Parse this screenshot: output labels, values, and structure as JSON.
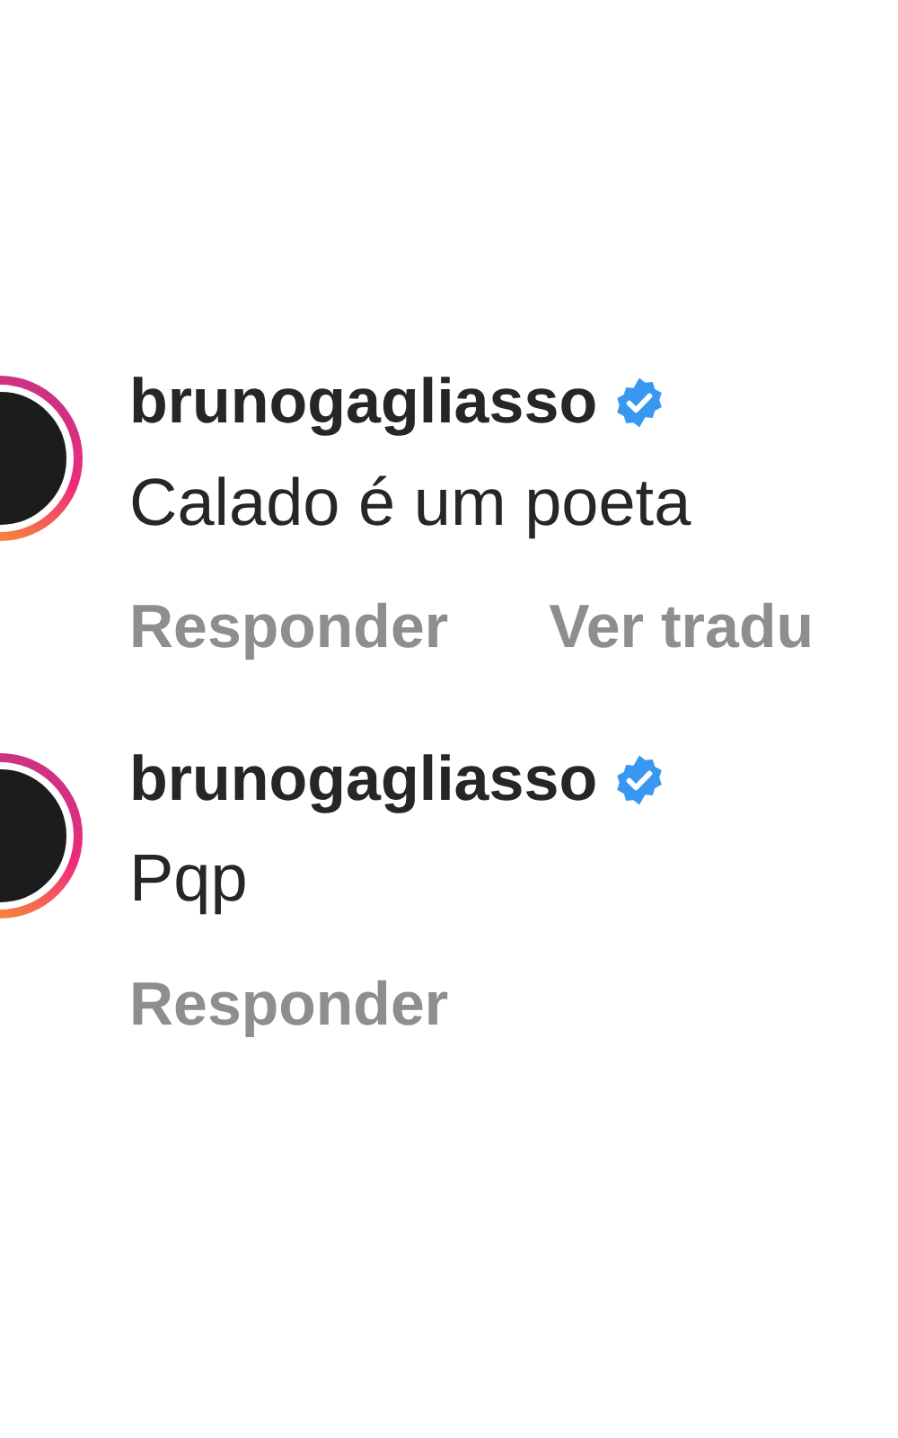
{
  "comments": [
    {
      "username": "brunogagliasso",
      "verified": true,
      "story_ring": true,
      "text": "Calado é um poeta",
      "actions": [
        "Responder",
        "Ver tradu"
      ]
    },
    {
      "username": "brunogagliasso",
      "verified": true,
      "story_ring": true,
      "text": "Pqp",
      "actions": [
        "Responder"
      ]
    }
  ]
}
